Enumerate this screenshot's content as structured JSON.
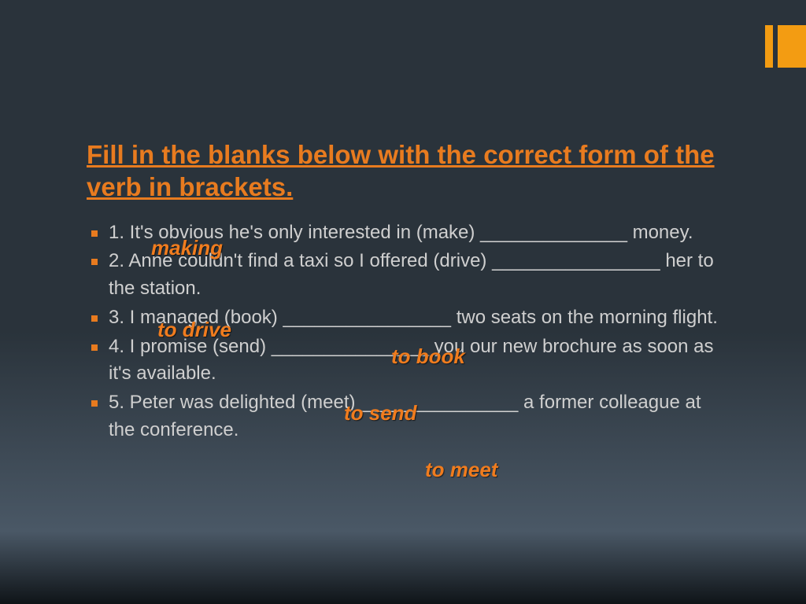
{
  "title": "Fill in the blanks below with the correct form of the verb in brackets.",
  "items": [
    "1.    It's obvious he's only interested in (make) ______________ money.",
    "2.    Anne couldn't find a taxi so I offered (drive) ________________ her to the station.",
    "3.   I managed (book) ________________ two seats on the morning flight.",
    "4.   I promise (send) _______________ you our new brochure as soon as it's available.",
    "5.   Peter was delighted (meet) _______________ a former colleague at the conference."
  ],
  "answers": [
    "making",
    "to drive",
    "to book",
    "to send",
    "to meet"
  ],
  "accent": "#f39c12"
}
